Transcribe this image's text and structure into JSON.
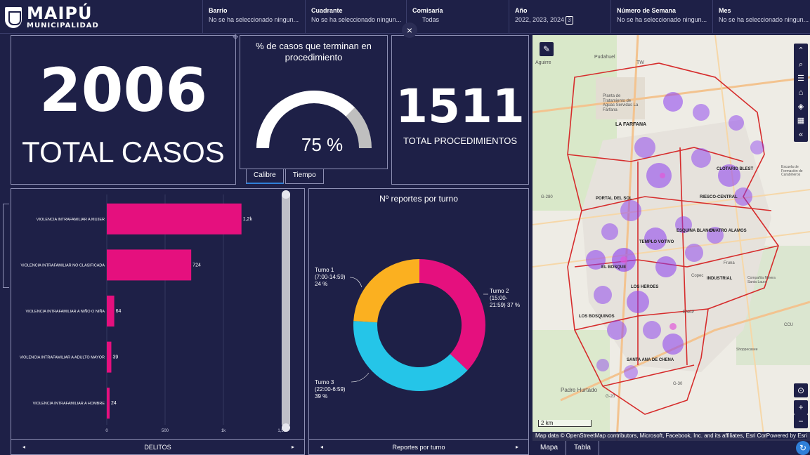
{
  "header": {
    "logo_title": "MAIPÚ",
    "logo_subtitle": "MUNICIPALIDAD",
    "filters": [
      {
        "label": "Barrio",
        "value": "No se ha seleccionado ningun..."
      },
      {
        "label": "Cuadrante",
        "value": "No se ha seleccionado ningun..."
      },
      {
        "label": "Comisaría",
        "value": "Todas"
      },
      {
        "label": "Año",
        "value": "2022, 2023, 2024",
        "badge": "3"
      },
      {
        "label": "Número de Semana",
        "value": "No se ha seleccionado ningun..."
      },
      {
        "label": "Mes",
        "value": "No se ha seleccionado ningun..."
      }
    ],
    "close_label": "×"
  },
  "kpi_casos": {
    "value": "2006",
    "label": "TOTAL CASOS"
  },
  "gauge": {
    "title": "% de casos que terminan en procedimiento",
    "value_label": "75 %",
    "fraction": 0.75,
    "tabs": [
      "Calibre",
      "Tiempo"
    ]
  },
  "kpi_procedimientos": {
    "value": "1511",
    "label": "TOTAL PROCEDIMIENTOS"
  },
  "bar_chart": {
    "footer_title": "DELITOS",
    "footer_left": "◂",
    "footer_right": "▸"
  },
  "donut_chart": {
    "footer_title": "Reportes por turno",
    "footer_left": "◂",
    "footer_right": "▸"
  },
  "chart_data": [
    {
      "type": "bar",
      "orientation": "horizontal",
      "categories": [
        "VIOLENCIA INTRAFAMILIAR A MUJER",
        "VIOLENCIA INTRAFAMILIAR NO CLASIFICADA",
        "VIOLENCIA INTRAFAMILIAR A NIÑO O NIÑA",
        "VIOLENCIA INTRAFAMILIAR A ADULTO MAYOR",
        "VIOLENCIA INTRAFAMILIAR A HOMBRE"
      ],
      "values": [
        1155,
        724,
        64,
        39,
        24
      ],
      "data_labels": [
        "1,2k",
        "724",
        "64",
        "39",
        "24"
      ],
      "xlim": [
        0,
        1500
      ],
      "x_ticks": [
        "0",
        "500",
        "1k",
        "1,5k"
      ],
      "color": "#e5107e"
    },
    {
      "type": "pie",
      "donut": true,
      "title": "Nº reportes por turno",
      "slices": [
        {
          "label": "Turno 1 (7:00-14:59) 24 %",
          "value": 24,
          "color": "#fbb020"
        },
        {
          "label": "Turno 2 (15:00-21:59) 37 %",
          "value": 37,
          "color": "#e5107e"
        },
        {
          "label": "Turno 3 (22:00-6:59) 39 %",
          "value": 39,
          "color": "#25c5e8"
        }
      ],
      "label_lines": {
        "t1": [
          "Turno 1",
          "(7:00-14:59)",
          "24 %"
        ],
        "t2": [
          "Turno 2",
          "(15:00-",
          "21:59) 37 %"
        ],
        "t3": [
          "Turno 3",
          "(22:00-6:59)",
          "39 %"
        ]
      }
    }
  ],
  "map": {
    "labels": [
      "Pudahuel",
      "Aguirre",
      "TW",
      "Planta de Tratamiento de Aguas Servidas La Farfana",
      "LA FARFANA",
      "CLOTARIO BLEST",
      "PORTAL DEL SOL",
      "RIESCO-CENTRAL",
      "ESQUINA BLANCA",
      "CUATRO ALAMOS",
      "TEMPLO VOTIVO",
      "EL BOSQUE",
      "LOS HEROES",
      "INDUSTRIAL",
      "LOS BOSQUINOS",
      "ENAP",
      "SANTA ANA DE CHENA",
      "Padre Hurtado",
      "Escuela de Formación de Carabineros",
      "Compañía Minera Santa Laura",
      "CCU",
      "Shoppecasee",
      "Fruna",
      "Copec",
      "G-280",
      "G-30",
      "G-20"
    ],
    "scale": "2 km",
    "attribution": "Map data © OpenStreetMap contributors, Microsoft, Facebook, Inc. and its affiliates, Esri Community...",
    "powered": "Powered by Esri",
    "tabs": [
      "Mapa",
      "Tabla"
    ],
    "tools": [
      "double-chevron-up-icon",
      "search-icon",
      "list-icon",
      "home-icon",
      "layers-icon",
      "qr-icon",
      "double-chevron-left-icon"
    ]
  },
  "colors": {
    "background": "#1e2047",
    "border": "#8d8fb3",
    "bar": "#e5107e",
    "gauge": "#ffffff",
    "gauge_rest": "#bfbfbf"
  }
}
